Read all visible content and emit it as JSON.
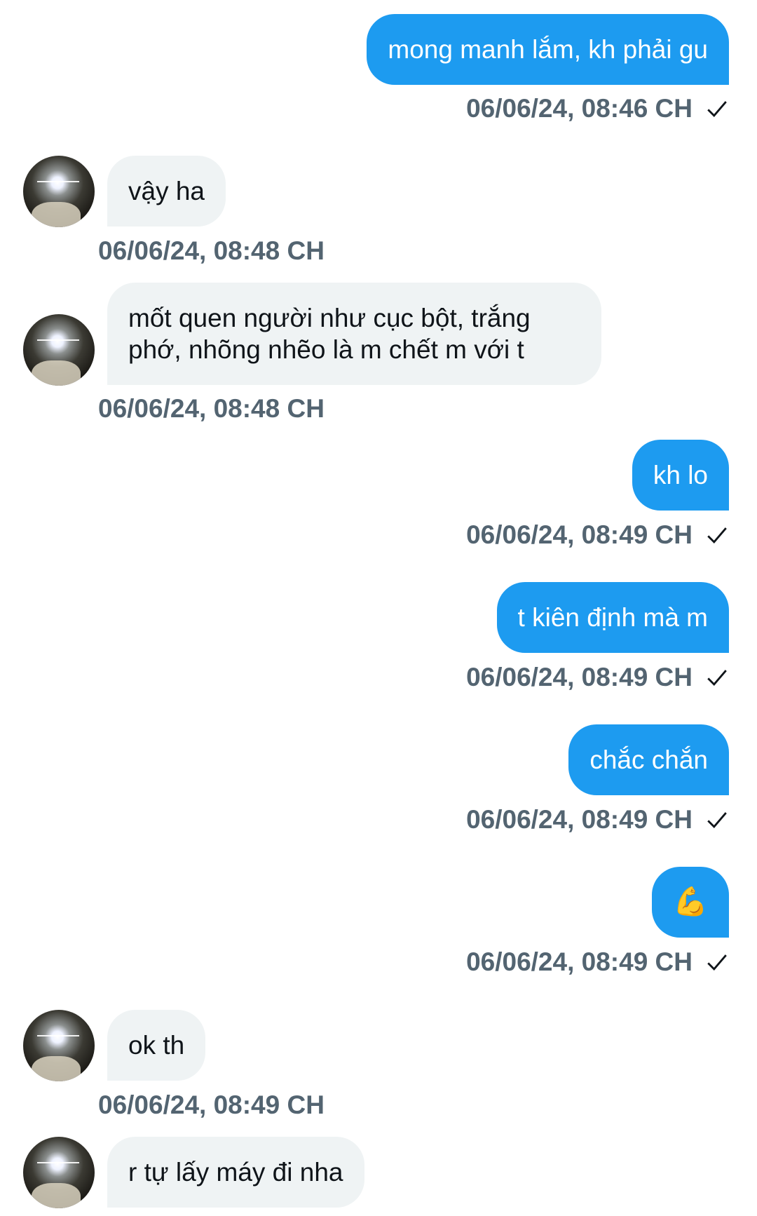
{
  "messages": [
    {
      "direction": "out",
      "text": "mong manh lắm, kh phải gu",
      "timestamp": "06/06/24, 08:46 CH",
      "read_icon": "check-icon"
    },
    {
      "direction": "in",
      "text": "vậy ha",
      "timestamp": "06/06/24, 08:48 CH",
      "avatar_icon": "avatar-photo"
    },
    {
      "direction": "in",
      "text": "mốt quen người như cục bột, trắng phớ, nhõng nhẽo là m chết m với t",
      "timestamp": "06/06/24, 08:48 CH",
      "avatar_icon": "avatar-photo"
    },
    {
      "direction": "out",
      "text": "kh lo",
      "timestamp": "06/06/24, 08:49 CH",
      "read_icon": "check-icon"
    },
    {
      "direction": "out",
      "text": "t kiên định mà m",
      "timestamp": "06/06/24, 08:49 CH",
      "read_icon": "check-icon"
    },
    {
      "direction": "out",
      "text": "chắc chắn",
      "timestamp": "06/06/24, 08:49 CH",
      "read_icon": "check-icon"
    },
    {
      "direction": "out",
      "text": "💪",
      "timestamp": "06/06/24, 08:49 CH",
      "read_icon": "check-icon"
    },
    {
      "direction": "in",
      "text": "ok th",
      "timestamp": "06/06/24, 08:49 CH",
      "avatar_icon": "avatar-photo"
    },
    {
      "direction": "in",
      "text": "r tự lấy máy đi nha",
      "timestamp": "",
      "avatar_icon": "avatar-photo"
    }
  ],
  "colors": {
    "outgoing_bubble": "#1d9bf0",
    "incoming_bubble": "#eff3f4",
    "timestamp_text": "#536471"
  }
}
